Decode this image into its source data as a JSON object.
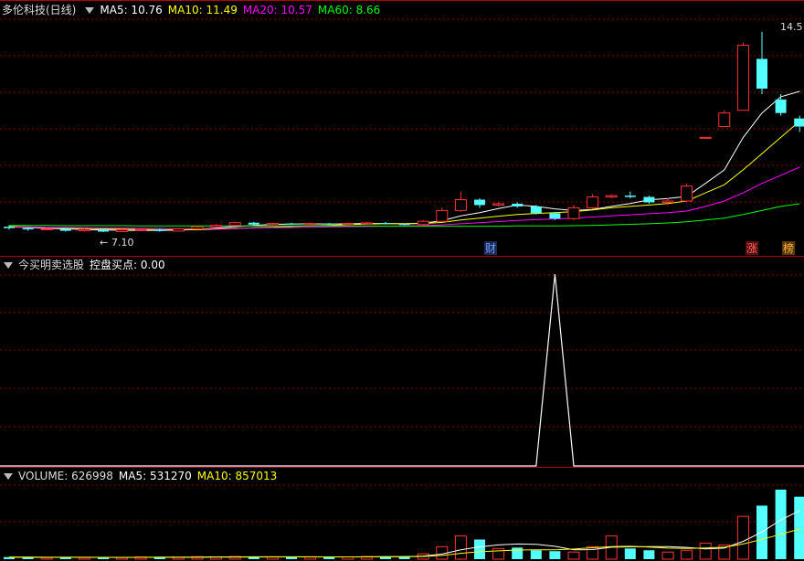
{
  "price_header": {
    "stock_name": "多伦科技(日线)",
    "ma5": "MA5: 10.76",
    "ma10": "MA10: 11.49",
    "ma20": "MA20: 10.57",
    "ma60": "MA60: 8.66"
  },
  "indicator_header": {
    "name": "今买明卖选股",
    "value": "控盘买点: 0.00"
  },
  "volume_header": {
    "volume": "VOLUME: 626998",
    "ma5": "MA5: 531270",
    "ma10": "MA10: 857013"
  },
  "colors": {
    "up": "#ff3232",
    "down": "#54ffff",
    "ma5": "#ffffff",
    "ma10": "#ffff00",
    "ma20": "#ff00ff",
    "ma60": "#00ff00",
    "grid": "#8a0000",
    "separator": "#b00000"
  },
  "chart_data": [
    {
      "type": "candlestick",
      "annotations": {
        "low_label": "7.10",
        "high_label": "14.5",
        "badge_cai": "财",
        "badge_zhang": "涨",
        "badge_bang": "榜"
      },
      "ylim": [
        6.9,
        15.0
      ],
      "candles": [
        {
          "o": 7.3,
          "c": 7.25,
          "h": 7.35,
          "l": 7.2
        },
        {
          "o": 7.25,
          "c": 7.2,
          "h": 7.28,
          "l": 7.15
        },
        {
          "o": 7.2,
          "c": 7.22,
          "h": 7.26,
          "l": 7.17
        },
        {
          "o": 7.22,
          "c": 7.15,
          "h": 7.24,
          "l": 7.12
        },
        {
          "o": 7.15,
          "c": 7.2,
          "h": 7.25,
          "l": 7.12
        },
        {
          "o": 7.2,
          "c": 7.12,
          "h": 7.22,
          "l": 7.1
        },
        {
          "o": 7.12,
          "c": 7.18,
          "h": 7.22,
          "l": 7.1
        },
        {
          "o": 7.18,
          "c": 7.2,
          "h": 7.24,
          "l": 7.15
        },
        {
          "o": 7.2,
          "c": 7.14,
          "h": 7.24,
          "l": 7.12
        },
        {
          "o": 7.14,
          "c": 7.22,
          "h": 7.26,
          "l": 7.12
        },
        {
          "o": 7.22,
          "c": 7.3,
          "h": 7.34,
          "l": 7.2
        },
        {
          "o": 7.3,
          "c": 7.35,
          "h": 7.4,
          "l": 7.28
        },
        {
          "o": 7.35,
          "c": 7.45,
          "h": 7.48,
          "l": 7.32
        },
        {
          "o": 7.45,
          "c": 7.38,
          "h": 7.48,
          "l": 7.35
        },
        {
          "o": 7.38,
          "c": 7.42,
          "h": 7.45,
          "l": 7.35
        },
        {
          "o": 7.42,
          "c": 7.4,
          "h": 7.45,
          "l": 7.38
        },
        {
          "o": 7.4,
          "c": 7.42,
          "h": 7.45,
          "l": 7.38
        },
        {
          "o": 7.42,
          "c": 7.4,
          "h": 7.44,
          "l": 7.38
        },
        {
          "o": 7.4,
          "c": 7.42,
          "h": 7.46,
          "l": 7.38
        },
        {
          "o": 7.42,
          "c": 7.44,
          "h": 7.48,
          "l": 7.4
        },
        {
          "o": 7.44,
          "c": 7.4,
          "h": 7.48,
          "l": 7.38
        },
        {
          "o": 7.4,
          "c": 7.38,
          "h": 7.42,
          "l": 7.35
        },
        {
          "o": 7.38,
          "c": 7.5,
          "h": 7.55,
          "l": 7.35
        },
        {
          "o": 7.5,
          "c": 7.9,
          "h": 8.0,
          "l": 7.48
        },
        {
          "o": 7.9,
          "c": 8.3,
          "h": 8.6,
          "l": 7.85
        },
        {
          "o": 8.3,
          "c": 8.1,
          "h": 8.35,
          "l": 8.0
        },
        {
          "o": 8.1,
          "c": 8.15,
          "h": 8.2,
          "l": 8.05
        },
        {
          "o": 8.15,
          "c": 8.05,
          "h": 8.2,
          "l": 8.0
        },
        {
          "o": 8.05,
          "c": 7.8,
          "h": 8.1,
          "l": 7.75
        },
        {
          "o": 7.8,
          "c": 7.6,
          "h": 7.85,
          "l": 7.55
        },
        {
          "o": 7.6,
          "c": 8.0,
          "h": 8.1,
          "l": 7.55
        },
        {
          "o": 8.0,
          "c": 8.4,
          "h": 8.5,
          "l": 7.95
        },
        {
          "o": 8.4,
          "c": 8.45,
          "h": 8.5,
          "l": 8.35
        },
        {
          "o": 8.45,
          "c": 8.4,
          "h": 8.6,
          "l": 8.35
        },
        {
          "o": 8.4,
          "c": 8.2,
          "h": 8.45,
          "l": 8.15
        },
        {
          "o": 8.2,
          "c": 8.25,
          "h": 8.35,
          "l": 8.1
        },
        {
          "o": 8.25,
          "c": 8.8,
          "h": 8.9,
          "l": 8.2
        },
        {
          "o": 10.6,
          "c": 10.6,
          "h": 10.6,
          "l": 10.6
        },
        {
          "o": 11.0,
          "c": 11.5,
          "h": 11.6,
          "l": 11.0
        },
        {
          "o": 11.6,
          "c": 14.0,
          "h": 14.1,
          "l": 11.6
        },
        {
          "o": 13.5,
          "c": 12.4,
          "h": 14.5,
          "l": 12.2
        },
        {
          "o": 12.0,
          "c": 11.5,
          "h": 12.2,
          "l": 11.4
        },
        {
          "o": 11.3,
          "c": 11.0,
          "h": 11.4,
          "l": 10.8
        }
      ],
      "ma_series": [
        {
          "name": "MA5",
          "values": [
            7.31,
            7.27,
            7.24,
            7.22,
            7.2,
            7.18,
            7.17,
            7.16,
            7.17,
            7.17,
            7.21,
            7.25,
            7.3,
            7.35,
            7.39,
            7.4,
            7.41,
            7.4,
            7.41,
            7.42,
            7.42,
            7.41,
            7.43,
            7.52,
            7.7,
            7.82,
            7.97,
            8.1,
            8.05,
            7.96,
            7.9,
            7.94,
            8.05,
            8.16,
            8.29,
            8.34,
            8.42,
            8.9,
            9.4,
            10.6,
            11.5,
            12.1,
            12.3
          ]
        },
        {
          "name": "MA10",
          "values": [
            7.3,
            7.29,
            7.27,
            7.25,
            7.24,
            7.22,
            7.21,
            7.2,
            7.19,
            7.19,
            7.19,
            7.21,
            7.23,
            7.26,
            7.28,
            7.31,
            7.33,
            7.35,
            7.38,
            7.4,
            7.41,
            7.41,
            7.42,
            7.46,
            7.55,
            7.62,
            7.69,
            7.75,
            7.79,
            7.82,
            7.86,
            7.92,
            8.0,
            8.05,
            8.1,
            8.16,
            8.25,
            8.55,
            8.85,
            9.4,
            10.0,
            10.6,
            11.2
          ]
        },
        {
          "name": "MA20",
          "values": [
            7.28,
            7.28,
            7.27,
            7.27,
            7.26,
            7.25,
            7.25,
            7.24,
            7.24,
            7.23,
            7.23,
            7.23,
            7.24,
            7.25,
            7.26,
            7.27,
            7.28,
            7.29,
            7.3,
            7.31,
            7.32,
            7.33,
            7.34,
            7.37,
            7.41,
            7.45,
            7.49,
            7.53,
            7.56,
            7.59,
            7.62,
            7.66,
            7.7,
            7.74,
            7.78,
            7.82,
            7.88,
            8.05,
            8.25,
            8.55,
            8.9,
            9.2,
            9.5
          ]
        },
        {
          "name": "MA60",
          "values": [
            7.35,
            7.35,
            7.35,
            7.34,
            7.34,
            7.34,
            7.34,
            7.33,
            7.33,
            7.33,
            7.33,
            7.33,
            7.33,
            7.33,
            7.33,
            7.33,
            7.33,
            7.33,
            7.33,
            7.33,
            7.32,
            7.32,
            7.32,
            7.32,
            7.32,
            7.32,
            7.32,
            7.33,
            7.33,
            7.33,
            7.34,
            7.35,
            7.37,
            7.39,
            7.41,
            7.44,
            7.48,
            7.55,
            7.62,
            7.75,
            7.9,
            8.05,
            8.15
          ]
        }
      ]
    },
    {
      "type": "line",
      "name": "控盘买点",
      "ylim": [
        0,
        1
      ],
      "spike_at_index": 29,
      "values": [
        0,
        0,
        0,
        0,
        0,
        0,
        0,
        0,
        0,
        0,
        0,
        0,
        0,
        0,
        0,
        0,
        0,
        0,
        0,
        0,
        0,
        0,
        0,
        0,
        0,
        0,
        0,
        0,
        0,
        1,
        0,
        0,
        0,
        0,
        0,
        0,
        0,
        0,
        0,
        0,
        0,
        0,
        0
      ]
    },
    {
      "type": "bar",
      "name": "VOLUME",
      "ylim": [
        0,
        4200000
      ],
      "values": [
        120000,
        110000,
        90000,
        100000,
        95000,
        90000,
        100000,
        130000,
        120000,
        110000,
        140000,
        130000,
        150000,
        110000,
        130000,
        140000,
        120000,
        110000,
        130000,
        150000,
        140000,
        150000,
        300000,
        700000,
        1300000,
        1100000,
        600000,
        650000,
        500000,
        450000,
        400000,
        700000,
        1300000,
        600000,
        500000,
        400000,
        500000,
        900000,
        800000,
        2400000,
        3000000,
        3900000,
        3500000
      ],
      "ma5": [
        110000,
        108000,
        104000,
        102000,
        103000,
        101000,
        95000,
        101000,
        107000,
        110000,
        120000,
        126000,
        130000,
        132000,
        132000,
        132000,
        134000,
        130000,
        128000,
        130000,
        138000,
        140000,
        174000,
        288000,
        528000,
        690000,
        800000,
        850000,
        830000,
        720000,
        520000,
        540000,
        670000,
        690000,
        700000,
        700000,
        660000,
        580000,
        620000,
        1000000,
        1520000,
        2200000,
        2720000
      ],
      "ma10": [
        115000,
        113000,
        110000,
        108000,
        106000,
        104000,
        103000,
        104000,
        106000,
        106000,
        110000,
        116000,
        120000,
        122000,
        124000,
        128000,
        130000,
        128000,
        130000,
        132000,
        134000,
        138000,
        152000,
        210000,
        330000,
        415000,
        466000,
        510000,
        526000,
        530000,
        570000,
        640000,
        700000,
        720000,
        680000,
        620000,
        600000,
        630000,
        670000,
        850000,
        1110000,
        1400000,
        1690000
      ]
    }
  ]
}
